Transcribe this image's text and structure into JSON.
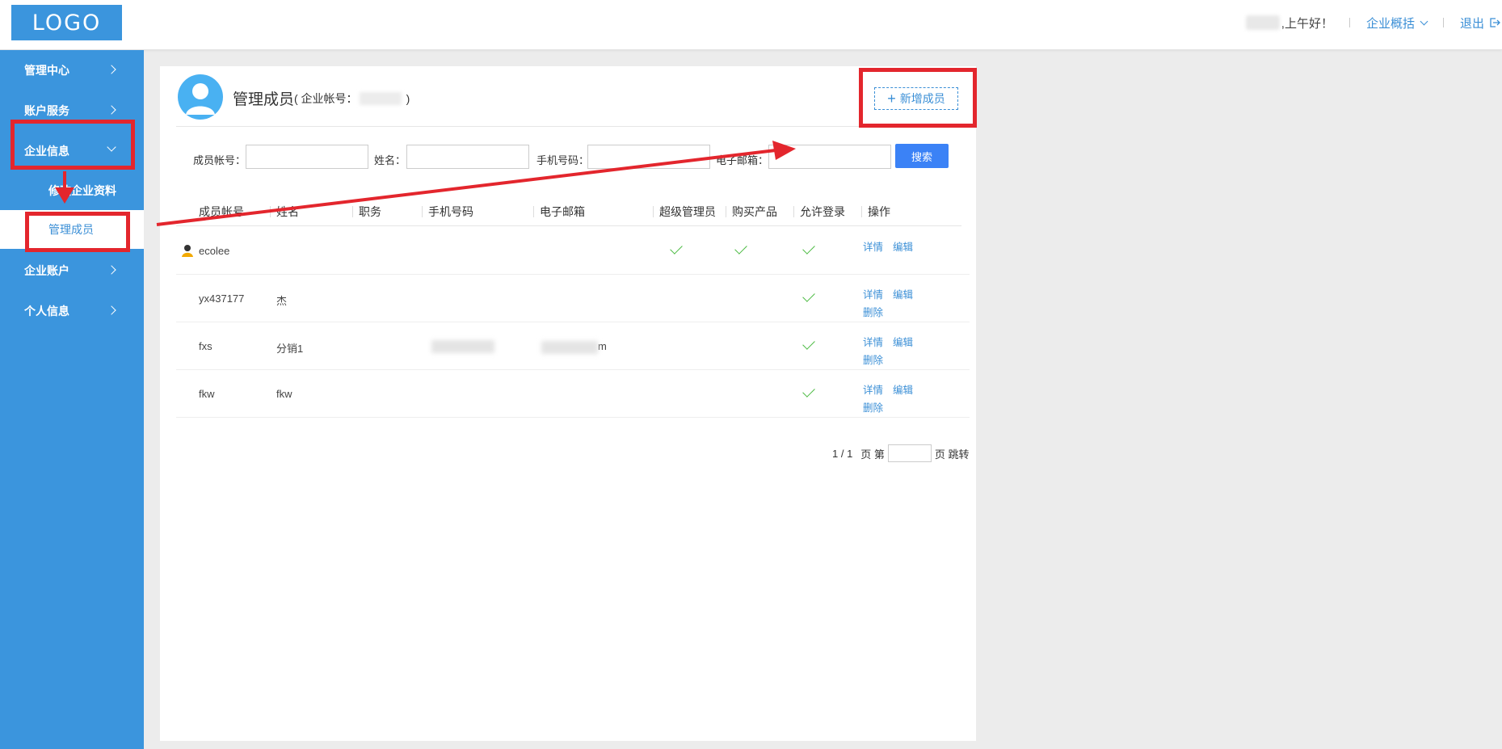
{
  "header": {
    "logo": "LOGO",
    "greeting": ",上午好！",
    "overview": "企业概括",
    "logout": "退出"
  },
  "sidebar": {
    "items": [
      {
        "label": "管理中心"
      },
      {
        "label": "账户服务"
      },
      {
        "label": "企业信息"
      },
      {
        "label": "企业账户"
      },
      {
        "label": "个人信息"
      }
    ],
    "sub_items": [
      {
        "label": "修改企业资料"
      },
      {
        "label": "管理成员"
      }
    ]
  },
  "main": {
    "title": "管理成员",
    "subtitle_prefix": "( 企业帐号：",
    "subtitle_suffix": ")",
    "add_button": "新增成员",
    "search": {
      "account_label": "成员帐号：",
      "name_label": "姓名：",
      "phone_label": "手机号码：",
      "email_label": "电子邮箱：",
      "button": "搜索"
    },
    "columns": [
      "成员帐号",
      "姓名",
      "职务",
      "手机号码",
      "电子邮箱",
      "超级管理员",
      "购买产品",
      "允许登录",
      "操作"
    ],
    "rows": [
      {
        "account": "ecolee",
        "name": "",
        "super_admin": true,
        "purchase": true,
        "login": true,
        "ops": [
          "详情",
          "编辑"
        ]
      },
      {
        "account": "yx437177",
        "name": "杰",
        "super_admin": false,
        "purchase": false,
        "login": true,
        "ops": [
          "详情",
          "编辑",
          "删除"
        ]
      },
      {
        "account": "fxs",
        "name": "分销1",
        "email_tail": "m",
        "super_admin": false,
        "purchase": false,
        "login": true,
        "ops": [
          "详情",
          "编辑",
          "删除"
        ]
      },
      {
        "account": "fkw",
        "name": "fkw",
        "super_admin": false,
        "purchase": false,
        "login": true,
        "ops": [
          "详情",
          "编辑",
          "删除"
        ]
      }
    ],
    "pager": {
      "info": "1 / 1",
      "go_prefix": "页 第",
      "go_suffix": "页 跳转"
    }
  },
  "colors": {
    "sidebar": "#3b95dd",
    "link": "#3b8fd6",
    "search_button": "#3b82f6",
    "check": "#4cbb43",
    "annotation": "#e3262d"
  }
}
